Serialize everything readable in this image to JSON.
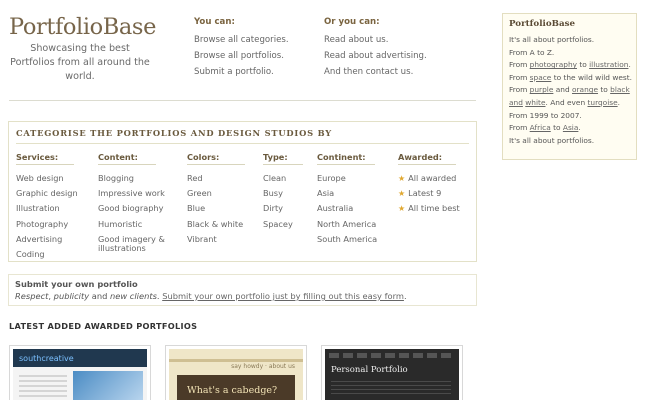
{
  "logo": {
    "title": "PortfolioBase",
    "tagline": "Showcasing the best Portfolios from all around the world."
  },
  "nav": {
    "col1": {
      "heading": "You can:",
      "links": [
        "Browse all categories.",
        "Browse all portfolios.",
        "Submit a portfolio."
      ]
    },
    "col2": {
      "heading": "Or you can:",
      "links": [
        "Read about us.",
        "Read about advertising.",
        "And then contact us."
      ]
    }
  },
  "categorise": {
    "title": "Categorise the portfolios and design studios by",
    "columns": [
      {
        "heading": "Services:",
        "items": [
          "Web design",
          "Graphic design",
          "Illustration",
          "Photography",
          "Advertising",
          "Coding"
        ]
      },
      {
        "heading": "Content:",
        "items": [
          "Blogging",
          "Impressive work",
          "Good biography",
          "Humoristic",
          "Good imagery & illustrations"
        ]
      },
      {
        "heading": "Colors:",
        "items": [
          "Red",
          "Green",
          "Blue",
          "Black & white",
          "Vibrant"
        ]
      },
      {
        "heading": "Type:",
        "items": [
          "Clean",
          "Busy",
          "Dirty",
          "Spacey"
        ]
      },
      {
        "heading": "Continent:",
        "items": [
          "Europe",
          "Asia",
          "Australia",
          "North America",
          "South America"
        ]
      },
      {
        "heading": "Awarded:",
        "items": [
          "All awarded",
          "Latest 9",
          "All time best"
        ]
      }
    ]
  },
  "submit": {
    "title": "Submit your own portfolio",
    "text_italic_1": "Respect",
    "text_sep": ", ",
    "text_italic_2": "publicity",
    "text_and": " and ",
    "text_italic_3": "new clients",
    "text_dot": ". ",
    "link": "Submit your own portfolio just by filling out this easy form",
    "end": "."
  },
  "latest": {
    "title": "Latest added awarded portfolios",
    "thumbs": [
      {
        "brand": "south",
        "brand2": "creative"
      },
      {
        "nav": "say howdy · about us",
        "hero": "What's a cabedge?"
      },
      {
        "title": "Personal Portfolio"
      }
    ]
  },
  "sidebar": {
    "title": "PortfolioBase",
    "l1": "It's all about portfolios.",
    "l2": "From A to Z.",
    "l3a": "From ",
    "l3b": "photography",
    "l3c": " to ",
    "l3d": "illustration",
    "l3e": ".",
    "l4a": "From ",
    "l4b": "space",
    "l4c": " to the wild wild west.",
    "l5a": "From ",
    "l5b": "purple",
    "l5c": " and ",
    "l5d": "orange",
    "l5e": " to ",
    "l5f": "black",
    "l6a": "and",
    "l6b": " ",
    "l6c": "white",
    "l6d": ". And even ",
    "l6e": "turqoise",
    "l6f": ".",
    "l7": "From 1999 to 2007.",
    "l8a": "From ",
    "l8b": "Africa",
    "l8c": " to ",
    "l8d": "Asia",
    "l8e": ".",
    "l9": "It's all about portfolios."
  },
  "colors": {
    "brand": "#77654a",
    "accent_star": "#e0a830",
    "sidebar_bg": "#fffdf2"
  }
}
